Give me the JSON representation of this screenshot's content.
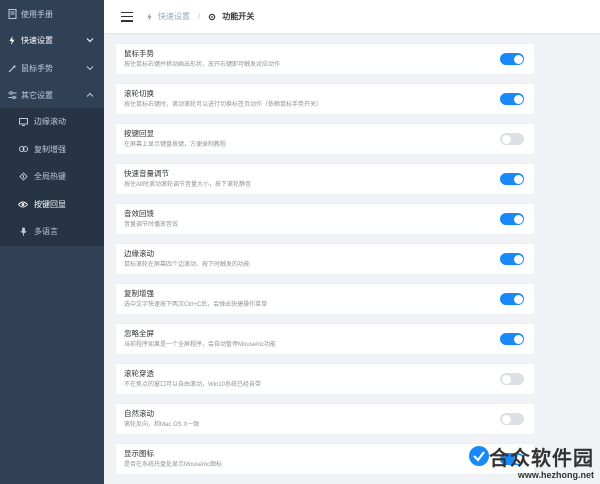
{
  "sidebar": {
    "items": [
      {
        "label": "使用手册",
        "icon": "document-icon"
      },
      {
        "label": "快速设置",
        "icon": "flash-icon"
      },
      {
        "label": "鼠标手势",
        "icon": "magic-wand-icon"
      },
      {
        "label": "其它设置",
        "icon": "sliders-icon"
      }
    ],
    "sub_items": [
      {
        "label": "边缘滚动",
        "icon": "monitor-icon"
      },
      {
        "label": "复制增强",
        "icon": "link-icon"
      },
      {
        "label": "全局热键",
        "icon": "hotkey-icon"
      },
      {
        "label": "按键回显",
        "icon": "eye-icon"
      },
      {
        "label": "多语言",
        "icon": "microphone-icon"
      }
    ]
  },
  "header": {
    "breadcrumb_parent": "快速设置",
    "breadcrumb_current": "功能开关"
  },
  "settings": [
    {
      "title": "鼠标手势",
      "desc": "按住鼠标右键并移动画出形状，放开右键即可触发对应动作",
      "on": true
    },
    {
      "title": "滚轮切换",
      "desc": "按住鼠标右键时，滚动滚轮可以进行切换标签页动作（依赖鼠标手势开关）",
      "on": true
    },
    {
      "title": "按键回显",
      "desc": "在屏幕上显示键盘按键，方便录制教程",
      "on": false
    },
    {
      "title": "快速音量调节",
      "desc": "按住Alt时滚动滚轮调节音量大小，按下滚轮静音",
      "on": true
    },
    {
      "title": "音效回馈",
      "desc": "音量调节时播放音效",
      "on": true
    },
    {
      "title": "边缘滚动",
      "desc": "鼠标滚轮在屏幕四个边滚动、按下时触发的功能",
      "on": true
    },
    {
      "title": "复制增强",
      "desc": "选中文字快速按下两次Ctrl+C后，会弹出快捷操作菜单",
      "on": true
    },
    {
      "title": "忽略全屏",
      "desc": "当前程序如果是一个全屏程序，会自动暂停MouseInc功能",
      "on": true
    },
    {
      "title": "滚轮穿透",
      "desc": "不在焦点的窗口可以自由滚动，Win10系统已经自带",
      "on": false
    },
    {
      "title": "自然滚动",
      "desc": "滚轮反向，和Mac OS X一致",
      "on": false
    },
    {
      "title": "显示图标",
      "desc": "是否在系统托盘处显示MouseInc图标",
      "on": true
    }
  ],
  "watermark": {
    "name": "合众软件园",
    "url": "www.hezhong.net"
  },
  "colors": {
    "sidebar_bg": "#304156",
    "submenu_bg": "#263445",
    "switch_on": "#1989fa",
    "switch_off": "#dcdfe6"
  }
}
